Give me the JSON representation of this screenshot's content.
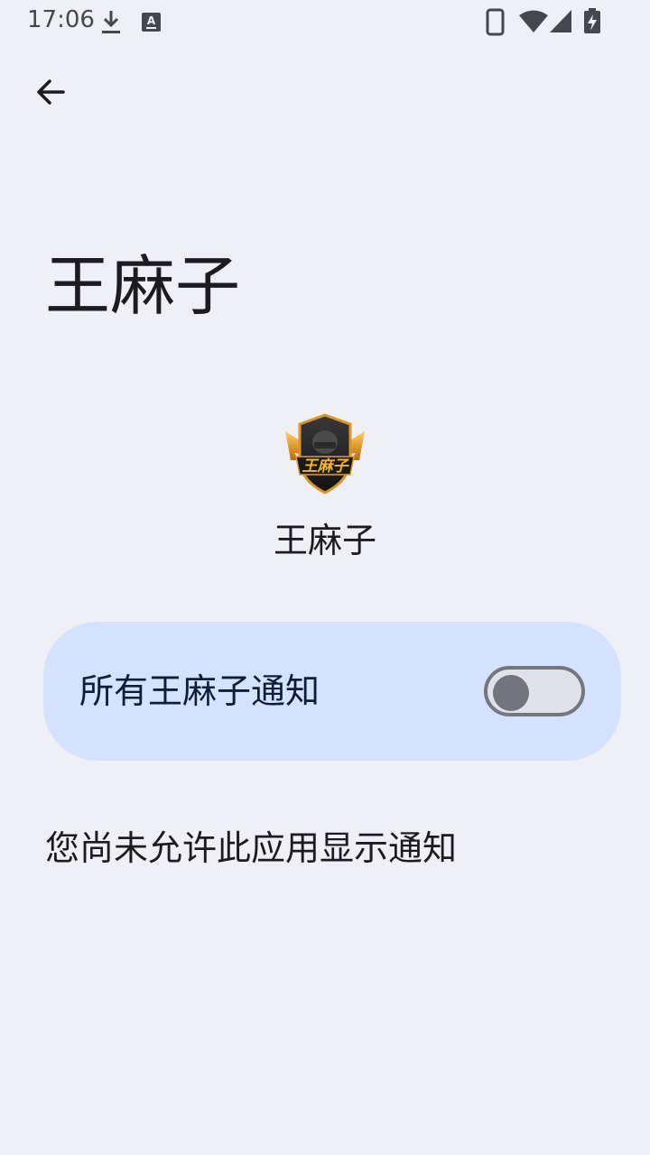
{
  "status_bar": {
    "time": "17:06",
    "icons": [
      "download-icon",
      "keyboard-a-icon",
      "phone-icon",
      "wifi-icon",
      "signal-icon",
      "battery-charging-icon"
    ]
  },
  "header": {
    "back_icon": "arrow-back-icon",
    "title": "王麻子"
  },
  "app": {
    "icon": "app-logo-icon",
    "name": "王麻子"
  },
  "notifications": {
    "toggle_label": "所有王麻子通知",
    "enabled": false,
    "notice": "您尚未允许此应用显示通知"
  },
  "colors": {
    "background": "#eff0f6",
    "card": "#d5e2fd",
    "switch_track": "#e0e1e9",
    "switch_outline": "#74777f",
    "text": "#1b1b21"
  }
}
